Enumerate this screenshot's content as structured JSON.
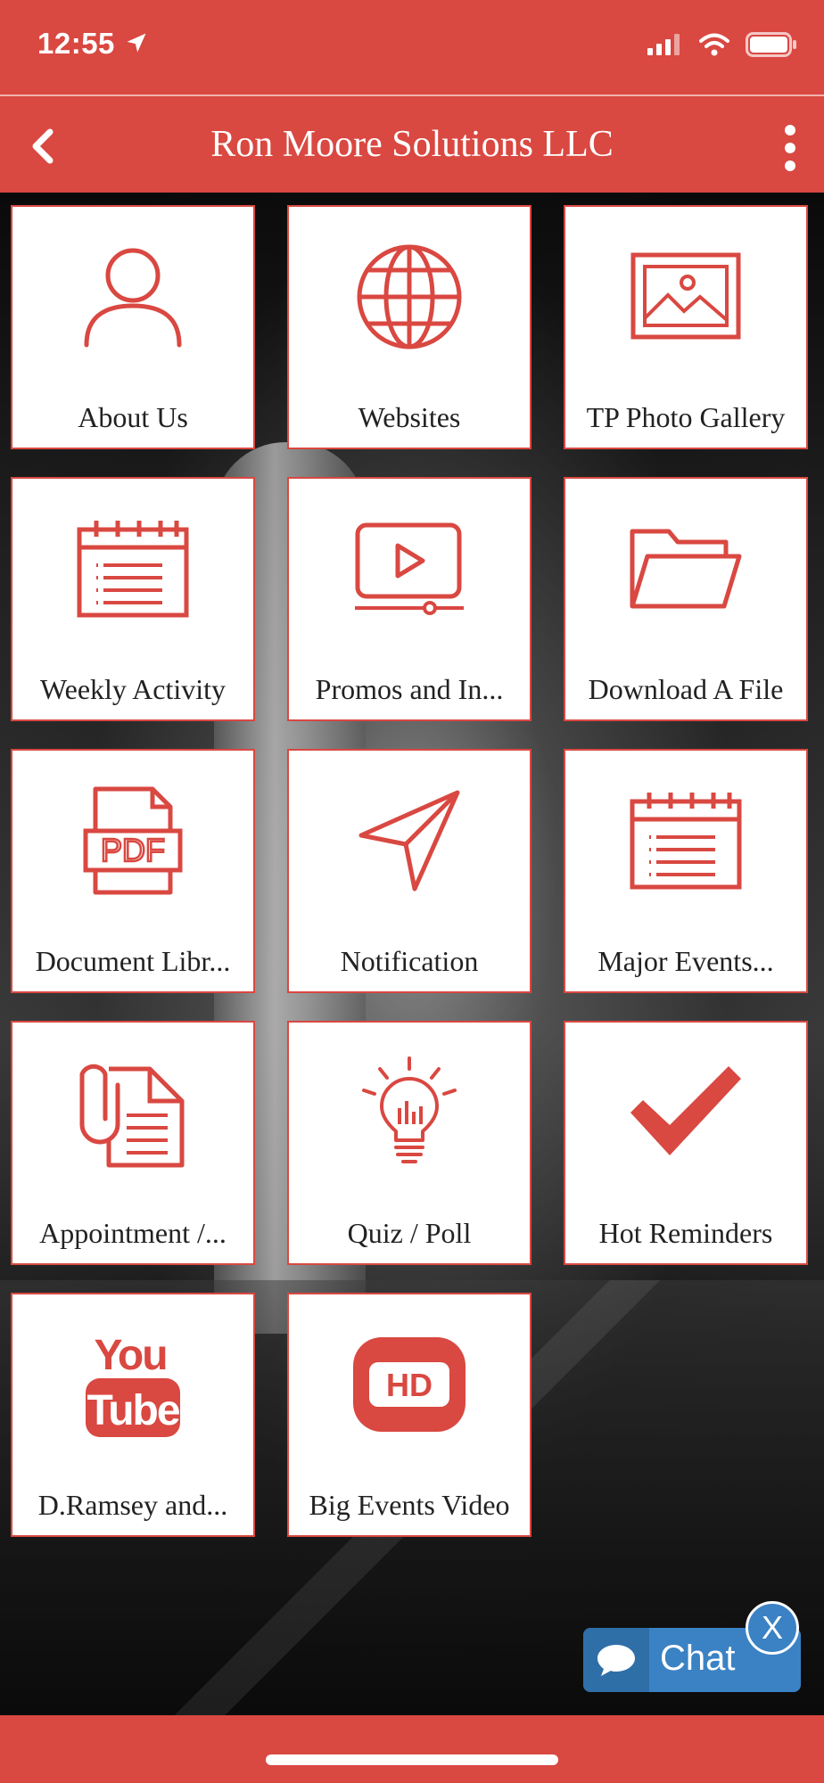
{
  "status_bar": {
    "time": "12:55"
  },
  "header": {
    "title": "Ron Moore Solutions LLC"
  },
  "tiles": [
    {
      "label": "About Us",
      "icon": "user-icon"
    },
    {
      "label": "Websites",
      "icon": "globe-icon"
    },
    {
      "label": "TP Photo Gallery",
      "icon": "image-icon"
    },
    {
      "label": "Weekly Activity",
      "icon": "calendar-icon"
    },
    {
      "label": "Promos and In...",
      "icon": "video-icon"
    },
    {
      "label": "Download A File",
      "icon": "folder-icon"
    },
    {
      "label": "Document Libr...",
      "icon": "pdf-icon"
    },
    {
      "label": "Notification",
      "icon": "paper-plane-icon"
    },
    {
      "label": "Major Events...",
      "icon": "calendar-icon"
    },
    {
      "label": "Appointment /...",
      "icon": "paperclip-document-icon"
    },
    {
      "label": "Quiz / Poll",
      "icon": "lightbulb-icon"
    },
    {
      "label": "Hot Reminders",
      "icon": "checkmark-icon"
    },
    {
      "label": "D.Ramsey and...",
      "icon": "youtube-icon"
    },
    {
      "label": "Big Events Video",
      "icon": "hd-video-icon"
    }
  ],
  "chat": {
    "label": "Chat",
    "close_label": "X"
  },
  "colors": {
    "brand": "#d94841",
    "chat": "#3b82c4"
  }
}
